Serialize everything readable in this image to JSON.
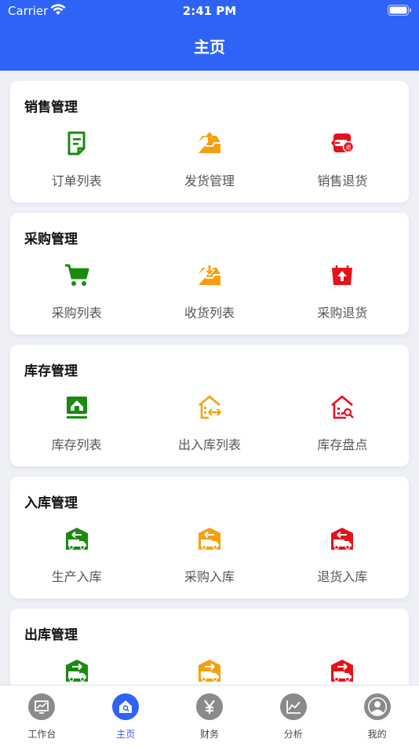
{
  "status_bar": {
    "carrier": "Carrier",
    "time": "2:41 PM"
  },
  "header": {
    "title": "主页"
  },
  "colors": {
    "primary": "#2e63f6",
    "green": "#1a8a10",
    "orange": "#f5a00a",
    "red": "#e8101a"
  },
  "sections": [
    {
      "title": "销售管理",
      "items": [
        {
          "label": "订单列表",
          "icon": "order-list-icon",
          "color": "green"
        },
        {
          "label": "发货管理",
          "icon": "shipping-tray-icon",
          "color": "orange"
        },
        {
          "label": "销售退货",
          "icon": "sales-return-icon",
          "color": "red"
        }
      ]
    },
    {
      "title": "采购管理",
      "items": [
        {
          "label": "采购列表",
          "icon": "shopping-cart-icon",
          "color": "green"
        },
        {
          "label": "收货列表",
          "icon": "receive-tray-icon",
          "color": "orange"
        },
        {
          "label": "采购退货",
          "icon": "purchase-return-icon",
          "color": "red"
        }
      ]
    },
    {
      "title": "库存管理",
      "items": [
        {
          "label": "库存列表",
          "icon": "warehouse-list-icon",
          "color": "green"
        },
        {
          "label": "出入库列表",
          "icon": "warehouse-transfer-icon",
          "color": "orange"
        },
        {
          "label": "库存盘点",
          "icon": "inventory-check-icon",
          "color": "red"
        }
      ]
    },
    {
      "title": "入库管理",
      "items": [
        {
          "label": "生产入库",
          "icon": "truck-in-icon",
          "color": "green"
        },
        {
          "label": "采购入库",
          "icon": "truck-in-icon",
          "color": "orange"
        },
        {
          "label": "退货入库",
          "icon": "truck-in-icon",
          "color": "red"
        }
      ]
    },
    {
      "title": "出库管理",
      "items": [
        {
          "label": "",
          "icon": "truck-out-icon",
          "color": "green"
        },
        {
          "label": "",
          "icon": "truck-out-icon",
          "color": "orange"
        },
        {
          "label": "",
          "icon": "truck-out-icon",
          "color": "red"
        }
      ]
    }
  ],
  "tabs": [
    {
      "label": "工作台",
      "icon": "workbench-icon",
      "active": false
    },
    {
      "label": "主页",
      "icon": "home-icon",
      "active": true
    },
    {
      "label": "财务",
      "icon": "yen-icon",
      "active": false
    },
    {
      "label": "分析",
      "icon": "analysis-chart-icon",
      "active": false
    },
    {
      "label": "我的",
      "icon": "profile-icon",
      "active": false
    }
  ]
}
